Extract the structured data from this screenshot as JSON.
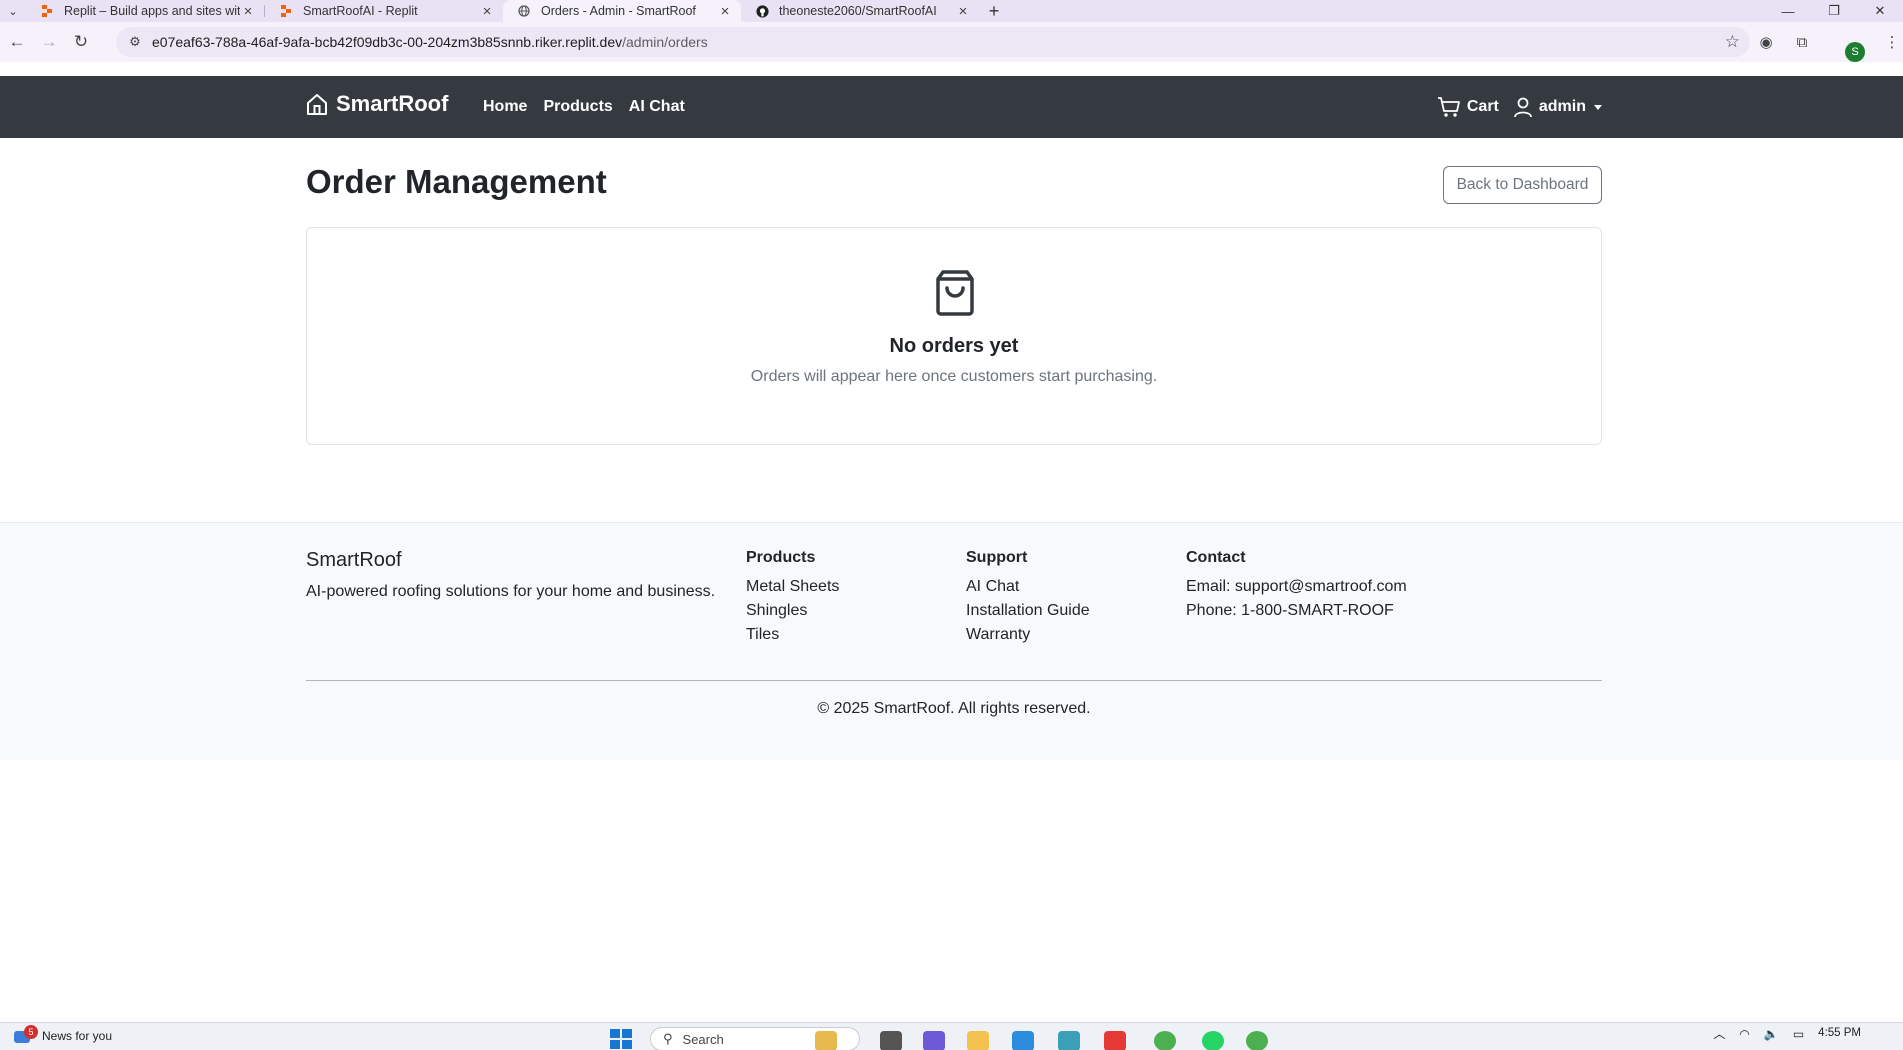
{
  "browser": {
    "tabs": [
      {
        "title": "Replit – Build apps and sites wit",
        "active": false
      },
      {
        "title": "SmartRoofAI - Replit",
        "active": false
      },
      {
        "title": "Orders - Admin - SmartRoof",
        "active": true
      },
      {
        "title": "theoneste2060/SmartRoofAI",
        "active": false
      }
    ],
    "url_host": "e07eaf63-788a-46af-9afa-bcb42f09db3c-00-204zm3b85snnb.riker.replit.dev",
    "url_path": "/admin/orders",
    "profile_initial": "S"
  },
  "navbar": {
    "brand": "SmartRoof",
    "links": [
      "Home",
      "Products",
      "AI Chat"
    ],
    "cart_label": "Cart",
    "user_label": "admin"
  },
  "main": {
    "title": "Order Management",
    "back_button": "Back to Dashboard",
    "empty_title": "No orders yet",
    "empty_text": "Orders will appear here once customers start purchasing."
  },
  "footer": {
    "brand": "SmartRoof",
    "tagline": "AI-powered roofing solutions for your home and business.",
    "columns": [
      {
        "heading": "Products",
        "items": [
          "Metal Sheets",
          "Shingles",
          "Tiles"
        ]
      },
      {
        "heading": "Support",
        "items": [
          "AI Chat",
          "Installation Guide",
          "Warranty"
        ]
      },
      {
        "heading": "Contact",
        "items": [
          "Email: support@smartroof.com",
          "Phone: 1-800-SMART-ROOF"
        ]
      }
    ],
    "copyright": "© 2025 SmartRoof. All rights reserved."
  },
  "taskbar": {
    "news_label": "News for you",
    "news_badge": "5",
    "search_placeholder": "Search",
    "time": "4:55 PM"
  },
  "colors": {
    "navbar_bg": "#343a40",
    "footer_bg": "#f8f9fa",
    "muted_text": "#6c757d"
  }
}
